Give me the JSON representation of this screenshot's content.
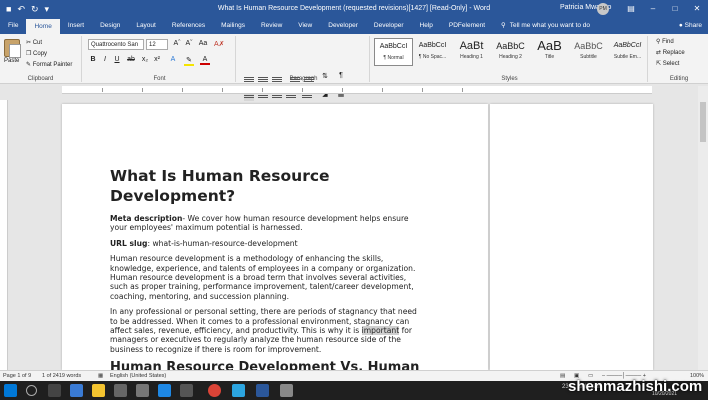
{
  "window": {
    "title": "What Is Human Resource Development (requested revisions)[1427] [Read-Only] - Word",
    "user_name": "Patricia Mwanzo",
    "user_initials": "PM"
  },
  "tabs": [
    "File",
    "Home",
    "Insert",
    "Design",
    "Layout",
    "References",
    "Mailings",
    "Review",
    "View",
    "Developer",
    "Developer",
    "Help",
    "PDFelement"
  ],
  "active_tab": "Home",
  "tell_me": "Tell me what you want to do",
  "share_label": "Share",
  "ribbon": {
    "clipboard": {
      "label": "Clipboard",
      "paste": "Paste",
      "cut": "Cut",
      "copy": "Copy",
      "format_painter": "Format Painter"
    },
    "font": {
      "label": "Font",
      "name": "Quattrocento San",
      "size": "12"
    },
    "paragraph": {
      "label": "Paragraph"
    },
    "styles": {
      "label": "Styles",
      "items": [
        {
          "sample": "AaBbCcI",
          "name": "¶ Normal"
        },
        {
          "sample": "AaBbCcI",
          "name": "¶ No Spac..."
        },
        {
          "sample": "AaBt",
          "name": "Heading 1"
        },
        {
          "sample": "AaBbC",
          "name": "Heading 2"
        },
        {
          "sample": "AaB",
          "name": "Title"
        },
        {
          "sample": "AaBbC",
          "name": "Subtitle"
        },
        {
          "sample": "AaBbCcI",
          "name": "Subtle Em..."
        }
      ]
    },
    "editing": {
      "label": "Editing",
      "find": "Find",
      "replace": "Replace",
      "select": "Select"
    }
  },
  "document": {
    "title": "What Is Human Resource Development?",
    "meta_label": "Meta description",
    "meta_text": "- We cover how human resource development helps ensure your employees' maximum potential is harnessed.",
    "slug_label": "URL slug",
    "slug_text": ": what-is-human-resource-development",
    "para1": "Human resource development is a methodology of enhancing the skills, knowledge, experience, and talents of employees in a company or organization. Human resource development is a broad term that involves several activities, such as proper training, performance improvement, talent/career development, coaching, mentoring, and succession planning.",
    "para2_before": "In any professional or personal setting, there are periods of stagnancy that need to be addressed. When it comes to a professional environment, stagnancy can affect sales, revenue, efficiency, and productivity. This is why it is ",
    "para2_highlight": "important",
    "para2_after": " for managers or executives to regularly analyze the human resource side of the business to recognize if there is room for improvement.",
    "heading2": "Human Resource Development Vs. Human"
  },
  "status": {
    "page": "Page 1 of 9",
    "words": "1 of 2419 words",
    "language": "English (United States)",
    "zoom": "100%"
  },
  "taskbar": {
    "weather": "23°C Light rain",
    "date": "10/20/2021"
  },
  "watermark": "shenmazhishi.com",
  "colors": {
    "word_blue": "#2b579a"
  }
}
